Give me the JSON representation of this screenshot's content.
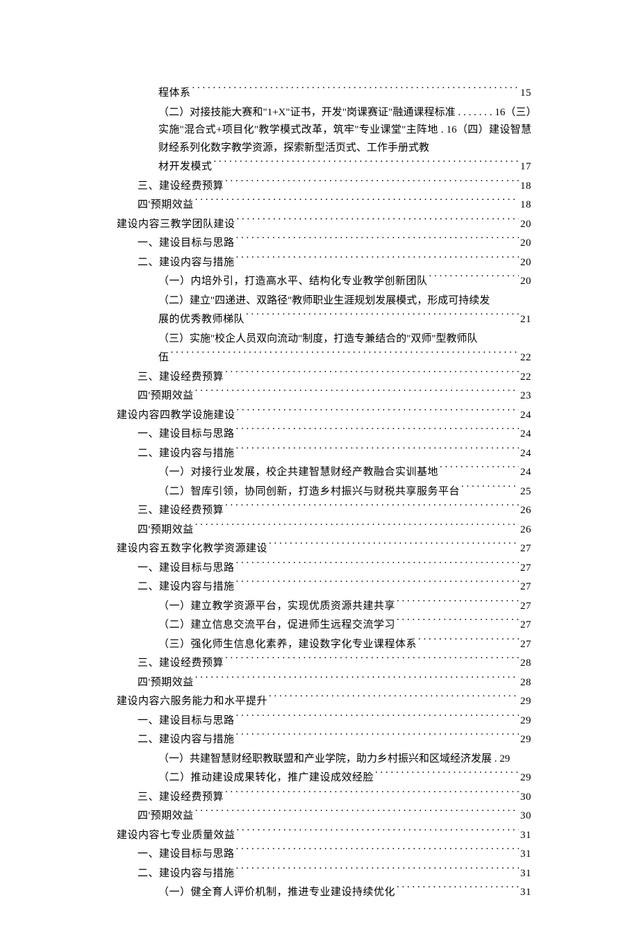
{
  "toc": [
    {
      "type": "dotline",
      "level": 2,
      "label": "程体系",
      "page": "15"
    },
    {
      "type": "wrap",
      "text": "（二）对接技能大赛和\"1+X\"证书，开发\"岗课赛证\"融通课程标准 . . . . . . . 16（三）实施\"混合式+项目化\"教学模式改革，筑牢\"专业课堂\"主阵地 . 16（四）建设智慧财经系列化数字教学资源，探索新型活页式、工作手册式教"
    },
    {
      "type": "dotline",
      "level": 2,
      "label": "材开发模式",
      "page": "17"
    },
    {
      "type": "dotline",
      "level": 1,
      "label": "三、建设经费预算",
      "page": "18"
    },
    {
      "type": "dotline",
      "level": 1,
      "label": "四'预期效益",
      "page": "18"
    },
    {
      "type": "dotline",
      "level": 0,
      "label": "建设内容三教学团队建设",
      "page": "20"
    },
    {
      "type": "dotline",
      "level": 1,
      "label": "一、建设目标与思路",
      "page": "20"
    },
    {
      "type": "dotline",
      "level": 1,
      "label": "二、建设内容与措施",
      "page": "20"
    },
    {
      "type": "dotline",
      "level": 2,
      "label": "（一）内培外引，打造高水平、结构化专业教学创新团队",
      "page": "20"
    },
    {
      "type": "wrap",
      "text": "（二）建立\"四递进、双路径\"教师职业生涯规划发展模式，形成可持续发"
    },
    {
      "type": "dotline",
      "level": 2,
      "label": "展的优秀教师梯队",
      "page": "21"
    },
    {
      "type": "wrap",
      "text": "（三）实施\"校企人员双向流动\"制度，打造专兼结合的\"双师\"型教师队"
    },
    {
      "type": "dotline",
      "level": 2,
      "label": "伍",
      "page": "22"
    },
    {
      "type": "dotline",
      "level": 1,
      "label": "三、建设经费预算",
      "page": "22"
    },
    {
      "type": "dotline",
      "level": 1,
      "label": "四'预期效益",
      "page": "23"
    },
    {
      "type": "dotline",
      "level": 0,
      "label": "建设内容四教学设施建设",
      "page": "24"
    },
    {
      "type": "dotline",
      "level": 1,
      "label": "一、建设目标与思路",
      "page": "24"
    },
    {
      "type": "dotline",
      "level": 1,
      "label": "二、建设内容与措施",
      "page": "24"
    },
    {
      "type": "dotline",
      "level": 2,
      "label": "（一）对接行业发展，校企共建智慧财经产教融合实训基地",
      "page": "24"
    },
    {
      "type": "dotline",
      "level": 2,
      "label": "（二）智库引领，协同创新，打造乡村振兴与财税共享服务平台",
      "page": "25"
    },
    {
      "type": "dotline",
      "level": 1,
      "label": "三、建设经费预算",
      "page": "26"
    },
    {
      "type": "dotline",
      "level": 1,
      "label": "四'预期效益",
      "page": "26"
    },
    {
      "type": "dotline",
      "level": 0,
      "label": "建设内容五数字化教学资源建设",
      "page": "27"
    },
    {
      "type": "dotline",
      "level": 1,
      "label": "一、建设目标与思路",
      "page": "27"
    },
    {
      "type": "dotline",
      "level": 1,
      "label": "二、建设内容与措施",
      "page": "27"
    },
    {
      "type": "dotline",
      "level": 2,
      "label": "（一）建立教学资源平台，实现优质资源共建共享",
      "page": "27"
    },
    {
      "type": "dotline",
      "level": 2,
      "label": "（二）建立信息交流平台，促进师生远程交流学习",
      "page": "27"
    },
    {
      "type": "dotline",
      "level": 2,
      "label": "（三）强化师生信息化素养，建设数字化专业课程体系",
      "page": "27"
    },
    {
      "type": "dotline",
      "level": 1,
      "label": "三、建设经费预算",
      "page": "28"
    },
    {
      "type": "dotline",
      "level": 1,
      "label": "四'预期效益",
      "page": "28"
    },
    {
      "type": "dotline",
      "level": 0,
      "label": "建设内容六服务能力和水平提升",
      "page": "29"
    },
    {
      "type": "dotline",
      "level": 1,
      "label": "一、建设目标与思路",
      "page": "29"
    },
    {
      "type": "dotline",
      "level": 1,
      "label": "二、建设内容与措施",
      "page": "29"
    },
    {
      "type": "wrap",
      "text": "（一）共建智慧财经职教联盟和产业学院，助力乡村振兴和区域经济发展 . 29"
    },
    {
      "type": "dotline",
      "level": 2,
      "label": "（二）推动建设成果转化，推广建设成效经脸",
      "page": "29"
    },
    {
      "type": "dotline",
      "level": 1,
      "label": "三、建设经费预算",
      "page": "30"
    },
    {
      "type": "dotline",
      "level": 1,
      "label": "四'预期效益",
      "page": "30"
    },
    {
      "type": "dotline",
      "level": 0,
      "label": "建设内容七专业质量效益",
      "page": "31"
    },
    {
      "type": "dotline",
      "level": 1,
      "label": "一、建设目标与思路",
      "page": "31"
    },
    {
      "type": "dotline",
      "level": 1,
      "label": "二、建设内容与措施",
      "page": "31"
    },
    {
      "type": "dotline",
      "level": 2,
      "label": "（一）健全育人评价机制，推进专业建设持续优化",
      "page": "31"
    }
  ]
}
